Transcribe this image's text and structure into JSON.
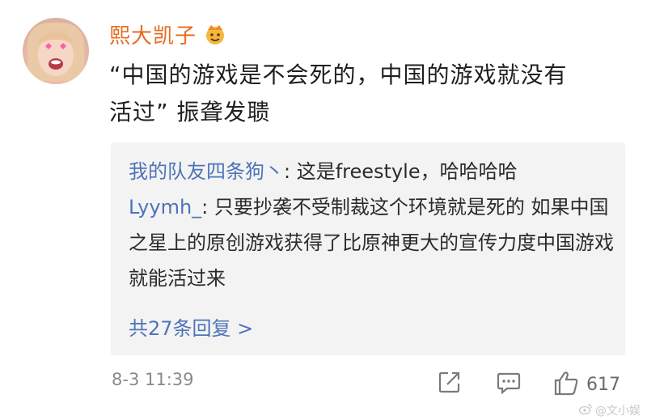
{
  "post": {
    "username": "熙大凯子",
    "text_line1": "“中国的游戏是不会死的，中国的游戏就没有",
    "text_line2": "活过” 振聋发聩",
    "timestamp": "8-3 11:39",
    "like_count": "617",
    "badge_icon": "crown-face-icon",
    "accent_color": "#e86a1e"
  },
  "comments": [
    {
      "author": "我的队友四条狗丶",
      "separator": ": ",
      "text": "这是freestyle，哈哈哈哈"
    },
    {
      "author": "Lyymh_",
      "separator": ": ",
      "text": "只要抄袭不受制裁这个环境就是死的 如果中国之星上的原创游戏获得了比原神更大的宣传力度中国游戏就能活过来"
    }
  ],
  "more_replies": "共27条回复 >",
  "watermark": "@文小娱",
  "link_color": "#4e74b8"
}
